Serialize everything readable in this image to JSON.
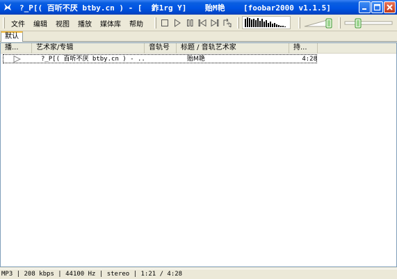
{
  "window": {
    "title": "?_P[( 百听不厌 btby.cn ) - [  鈼1rg Y]    贻M艳    [foobar2000 v1.1.5]"
  },
  "menu": {
    "items": [
      {
        "label": "文件"
      },
      {
        "label": "编辑"
      },
      {
        "label": "视图"
      },
      {
        "label": "播放"
      },
      {
        "label": "媒体库"
      },
      {
        "label": "帮助"
      }
    ]
  },
  "toolbar": {
    "buttons": [
      "stop-icon",
      "play-icon",
      "pause-icon",
      "previous-icon",
      "next-icon",
      "random-icon"
    ]
  },
  "tabs": [
    {
      "label": "默认"
    }
  ],
  "playlist": {
    "columns": [
      "播...",
      "艺术家/专辑",
      "音轨号",
      "标题 / 音轨艺术家",
      "持..."
    ],
    "rows": [
      {
        "artist_album": "?_P[( 百听不厌 btby.cn ) - ...",
        "track": "",
        "title": "贻M艳",
        "duration": "4:28"
      }
    ]
  },
  "status": {
    "text": "MP3 | 208 kbps | 44100 Hz | stereo | 1:21 / 4:28"
  }
}
